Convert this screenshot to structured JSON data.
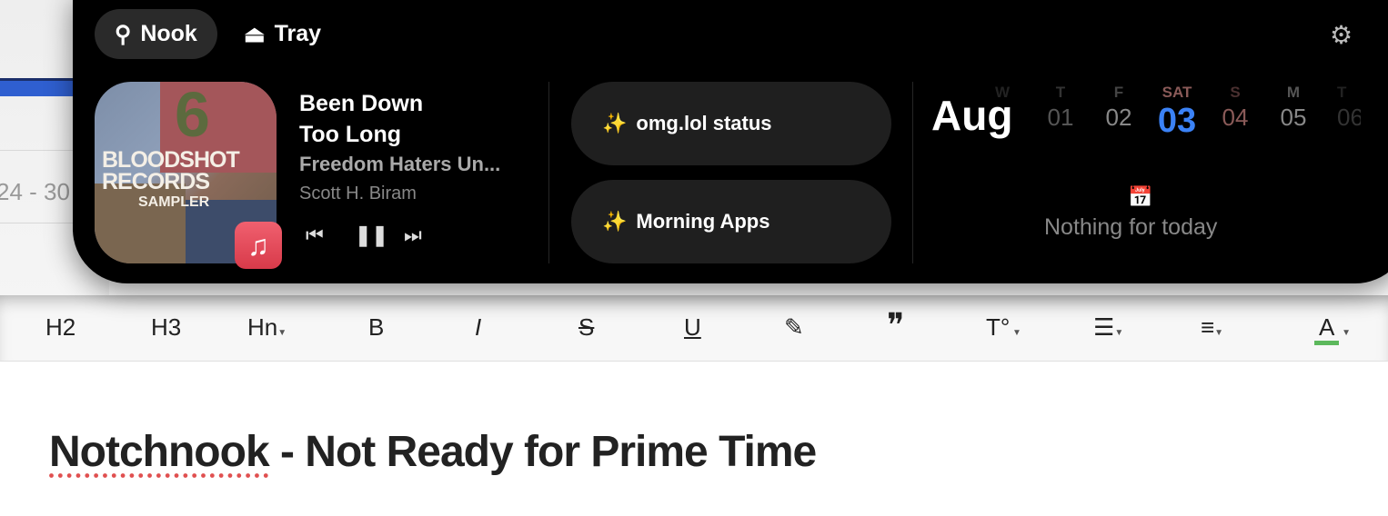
{
  "background_app": {
    "date_range": "24 - 30",
    "document_title_part1": "Notchnook",
    "document_title_part2": " - Not Ready for  Prime Time"
  },
  "toolbar": {
    "items": [
      {
        "label": "H2",
        "icon": "heading-2"
      },
      {
        "label": "H3",
        "icon": "heading-3"
      },
      {
        "label": "Hn",
        "icon": "heading-n",
        "dropdown": true
      },
      {
        "label": "B",
        "icon": "bold"
      },
      {
        "label": "I",
        "icon": "italic"
      },
      {
        "label": "S",
        "icon": "strikethrough"
      },
      {
        "label": "U",
        "icon": "underline"
      },
      {
        "label": "✎",
        "icon": "highlight"
      },
      {
        "label": "❞",
        "icon": "quote"
      },
      {
        "label": "T°",
        "icon": "text-format",
        "dropdown": true
      },
      {
        "label": "☰",
        "icon": "list",
        "dropdown": true
      },
      {
        "label": "≡",
        "icon": "align",
        "dropdown": true
      },
      {
        "label": "A",
        "icon": "text-color",
        "dropdown": true
      }
    ],
    "text_color_accent": "#5cb85c"
  },
  "nook": {
    "tabs": [
      {
        "label": "Nook",
        "icon": "desk-lamp",
        "active": true
      },
      {
        "label": "Tray",
        "icon": "tray",
        "active": false
      }
    ],
    "settings_icon": "gear",
    "now_playing": {
      "title_line1": "Been Down",
      "title_line2": "Too Long",
      "album": "Freedom Haters Un...",
      "artist": "Scott H. Biram",
      "source_app": "Music",
      "art_text1": "BLOODSHOT",
      "art_text2": "RECORDS",
      "art_text3": "SAMPLER",
      "art_num": "6",
      "state": "playing"
    },
    "shortcuts": [
      {
        "label": "omg.lol status",
        "icon": "sparkles"
      },
      {
        "label": "Morning Apps",
        "icon": "sparkles"
      }
    ],
    "calendar": {
      "month": "Aug",
      "days": [
        {
          "name": "W",
          "num": ""
        },
        {
          "name": "T",
          "num": "01"
        },
        {
          "name": "F",
          "num": "02"
        },
        {
          "name": "SAT",
          "num": "03",
          "today": true
        },
        {
          "name": "S",
          "num": "04"
        },
        {
          "name": "M",
          "num": "05"
        },
        {
          "name": "T",
          "num": "06"
        }
      ],
      "empty_message": "Nothing for today",
      "today_color": "#3b82f6",
      "weekend_color": "#8a5a58"
    }
  }
}
